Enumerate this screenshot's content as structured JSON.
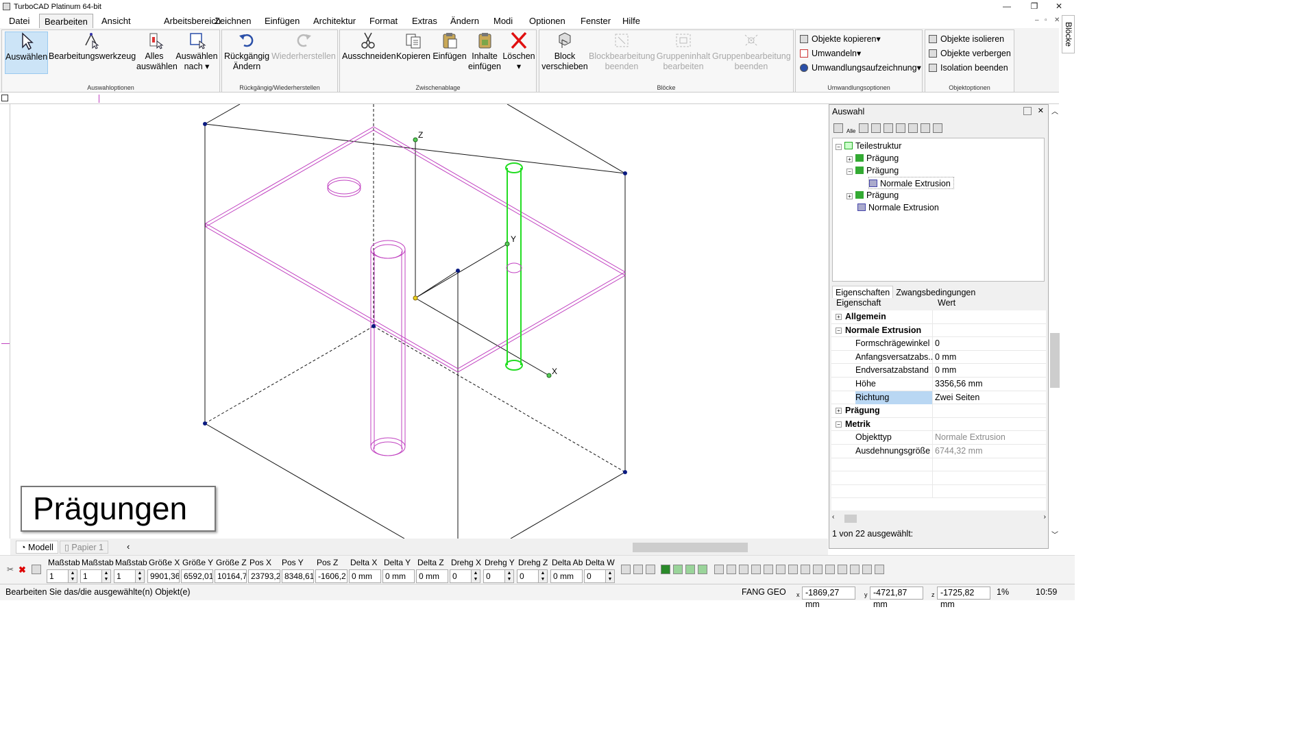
{
  "titlebar": {
    "title": "TurboCAD  Platinum 64-bit",
    "min": "—",
    "max": "❐",
    "close": "✕"
  },
  "menus": [
    "Datei",
    "Bearbeiten",
    "Ansicht",
    "Arbeitsbereich",
    "Zeichnen",
    "Einfügen",
    "Architektur",
    "Format",
    "Extras",
    "Ändern",
    "Modi",
    "Optionen",
    "Fenster",
    "Hilfe"
  ],
  "mdi": {
    "min": "–",
    "restore": "▫",
    "close": "✕"
  },
  "side_tab": "Blöcke",
  "ribbon": {
    "groups": [
      "Auswahloptionen",
      "Rückgängig/Wiederherstellen",
      "Zwischenablage",
      "Blöcke",
      "Umwandlungsoptionen",
      "Objektoptionen"
    ],
    "buttons": {
      "select": "Auswählen",
      "edit_tool": "Bearbeitungswerkzeug",
      "select_all_1": "Alles",
      "select_all_2": "auswählen",
      "select_by_1": "Auswählen",
      "select_by_2": "nach",
      "undo_1": "Rückgängig",
      "undo_2": "Ändern",
      "redo": "Wiederherstellen",
      "cut": "Ausschneiden",
      "copy": "Kopieren",
      "paste": "Einfügen",
      "paste_contents_1": "Inhalte",
      "paste_contents_2": "einfügen",
      "delete": "Löschen",
      "block_move_1": "Block",
      "block_move_2": "verschieben",
      "block_edit_end_1": "Blockbearbeitung",
      "block_edit_end_2": "beenden",
      "group_content_edit_1": "Gruppeninhalt",
      "group_content_edit_2": "bearbeiten",
      "group_edit_end_1": "Gruppenbearbeitung",
      "group_edit_end_2": "beenden",
      "copy_objects": "Objekte kopieren",
      "convert": "Umwandeln",
      "convert_record": "Umwandlungsaufzeichnung",
      "isolate": "Objekte isolieren",
      "hide": "Objekte verbergen",
      "end_isolation": "Isolation beenden"
    }
  },
  "canvas": {
    "label": "Prägungen",
    "axes": {
      "z": "Z",
      "y": "Y",
      "x": "X"
    }
  },
  "panel": {
    "title": "Auswahl",
    "toolbar_alle": "Alle",
    "tree": [
      {
        "label": "Teilestruktur",
        "expander": "−"
      },
      {
        "label": "Prägung",
        "expander": "+"
      },
      {
        "label": "Prägung",
        "expander": "−"
      },
      {
        "label": "Normale Extrusion",
        "expander": ""
      },
      {
        "label": "Prägung",
        "expander": "+"
      },
      {
        "label": "Normale Extrusion",
        "expander": ""
      }
    ],
    "tabs": [
      "Eigenschaften",
      "Zwangsbedingungen"
    ],
    "header": {
      "name": "Eigenschaft",
      "value": "Wert"
    },
    "rows": [
      {
        "name": "Allgemein",
        "value": "",
        "cat": true,
        "exp": "+"
      },
      {
        "name": "Normale Extrusion",
        "value": "",
        "cat": true,
        "exp": "−"
      },
      {
        "name": "Formschrägewinkel",
        "value": "0"
      },
      {
        "name": "Anfangsversatzabs...",
        "value": "0 mm"
      },
      {
        "name": "Endversatzabstand",
        "value": "0 mm"
      },
      {
        "name": "Höhe",
        "value": "3356,56 mm"
      },
      {
        "name": "Richtung",
        "value": "Zwei Seiten",
        "selected": true
      },
      {
        "name": "Prägung",
        "value": "",
        "cat": true,
        "exp": "+"
      },
      {
        "name": "Metrik",
        "value": "",
        "cat": true,
        "exp": "−"
      },
      {
        "name": "Objekttyp",
        "value": "Normale Extrusion",
        "gray": true
      },
      {
        "name": "Ausdehnungsgröße",
        "value": "6744,32 mm",
        "gray": true
      }
    ],
    "count": "1 von 22 ausgewählt:"
  },
  "tabs_bottom": {
    "model": "Modell",
    "paper": "Papier 1"
  },
  "coord": {
    "fields": [
      {
        "label": "Maßstab",
        "value": "1"
      },
      {
        "label": "Maßstab",
        "value": "1"
      },
      {
        "label": "Maßstab",
        "value": "1"
      },
      {
        "label": "Größe X",
        "value": "9901,36"
      },
      {
        "label": "Größe Y",
        "value": "6592,01"
      },
      {
        "label": "Größe Z",
        "value": "10164,7"
      },
      {
        "label": "Pos X",
        "value": "23793,2"
      },
      {
        "label": "Pos Y",
        "value": "8348,61"
      },
      {
        "label": "Pos Z",
        "value": "-1606,2"
      },
      {
        "label": "Delta X",
        "value": "0 mm"
      },
      {
        "label": "Delta Y",
        "value": "0 mm"
      },
      {
        "label": "Delta Z",
        "value": "0 mm"
      },
      {
        "label": "Drehg X",
        "value": "0"
      },
      {
        "label": "Drehg Y",
        "value": "0"
      },
      {
        "label": "Drehg Z",
        "value": "0"
      },
      {
        "label": "Delta Ab",
        "value": "0 mm"
      },
      {
        "label": "Delta W",
        "value": "0"
      }
    ]
  },
  "status": {
    "message": "Bearbeiten Sie das/die ausgewählte(n) Objekt(e)",
    "fang": "FANG",
    "geo": "GEO",
    "x": "-1869,27 mm",
    "y": "-4721,87 mm",
    "z": "-1725,82 mm",
    "zoom": "1%",
    "time": "10:59",
    "xl": "x",
    "yl": "y",
    "zl": "z"
  },
  "colors": {
    "magenta": "#c040c0",
    "green": "#22dd22",
    "blue": "#0a1a80",
    "accent": "#cce4f7"
  }
}
